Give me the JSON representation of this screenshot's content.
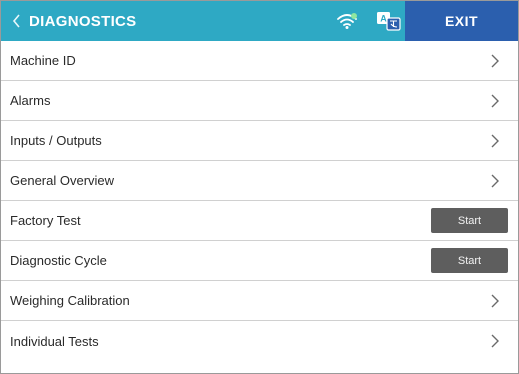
{
  "header": {
    "back_icon": "chevron-left-icon",
    "title": "DIAGNOSTICS",
    "wifi_icon": "wifi-icon",
    "language_icon": "language-translate-icon",
    "exit_label": "EXIT"
  },
  "colors": {
    "header_bg": "#2ea9c4",
    "exit_bg": "#2b5fae",
    "start_button_bg": "#5e5e5e",
    "divider": "#d0d0d0"
  },
  "menu": {
    "items": [
      {
        "label": "Machine ID",
        "action": "chevron"
      },
      {
        "label": "Alarms",
        "action": "chevron"
      },
      {
        "label": "Inputs / Outputs",
        "action": "chevron"
      },
      {
        "label": "General Overview",
        "action": "chevron"
      },
      {
        "label": "Factory Test",
        "action": "button",
        "button_label": "Start"
      },
      {
        "label": "Diagnostic Cycle",
        "action": "button",
        "button_label": "Start"
      },
      {
        "label": "Weighing Calibration",
        "action": "chevron"
      },
      {
        "label": "Individual Tests",
        "action": "chevron"
      }
    ]
  }
}
